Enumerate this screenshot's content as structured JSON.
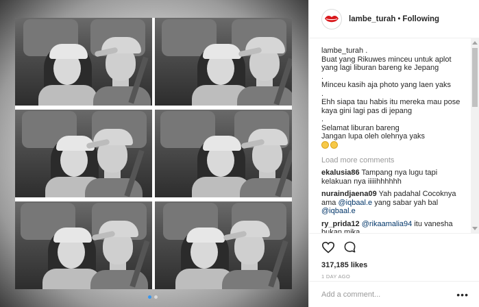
{
  "header": {
    "username": "lambe_turah",
    "separator": "•",
    "follow_status": "Following"
  },
  "caption": {
    "lines": [
      "lambe_turah .",
      "Buat yang Rikuwes minceu untuk aplot",
      "yang lagi liburan bareng ke Jepang",
      ".",
      "Minceu kasih aja photo yang laen yaks",
      ".",
      "Ehh siapa tau habis itu mereka mau pose",
      "kaya gini lagi pas di jepang",
      ".",
      "Selamat liburan bareng",
      "Jangan lupa oleh olehnya yaks"
    ],
    "emojis": [
      "smiling-face-emoji",
      "smiling-face-emoji"
    ]
  },
  "load_more": "Load more comments",
  "comments": [
    {
      "user": "ekalusia86",
      "text": "Tampang nya lugu tapi kelakuan nya iiiiihhhhhh"
    },
    {
      "user": "nuraindjaena09",
      "text": "Yah padahal Cocoknya ama",
      "mention": "@iqbaal.e",
      "text2": "yang sabar yah bal",
      "mention2": "@iqbaal.e"
    },
    {
      "user": "ry_prida12",
      "mention": "@rikaamalia94",
      "text": "itu vanesha bukan mika"
    }
  ],
  "actions": {
    "like_icon": "heart-icon",
    "comment_icon": "comment-bubble-icon",
    "likes": "317,185 likes",
    "time": "1 DAY AGO"
  },
  "add_comment": {
    "placeholder": "Add a comment...",
    "more_icon": "more-options-icon",
    "more_label": "•••"
  },
  "carousel": {
    "count": 2,
    "active_index": 0
  },
  "colors": {
    "link": "#003569",
    "muted": "#999999",
    "active_dot": "#3897f0",
    "avatar_lips": "#d9181c"
  }
}
